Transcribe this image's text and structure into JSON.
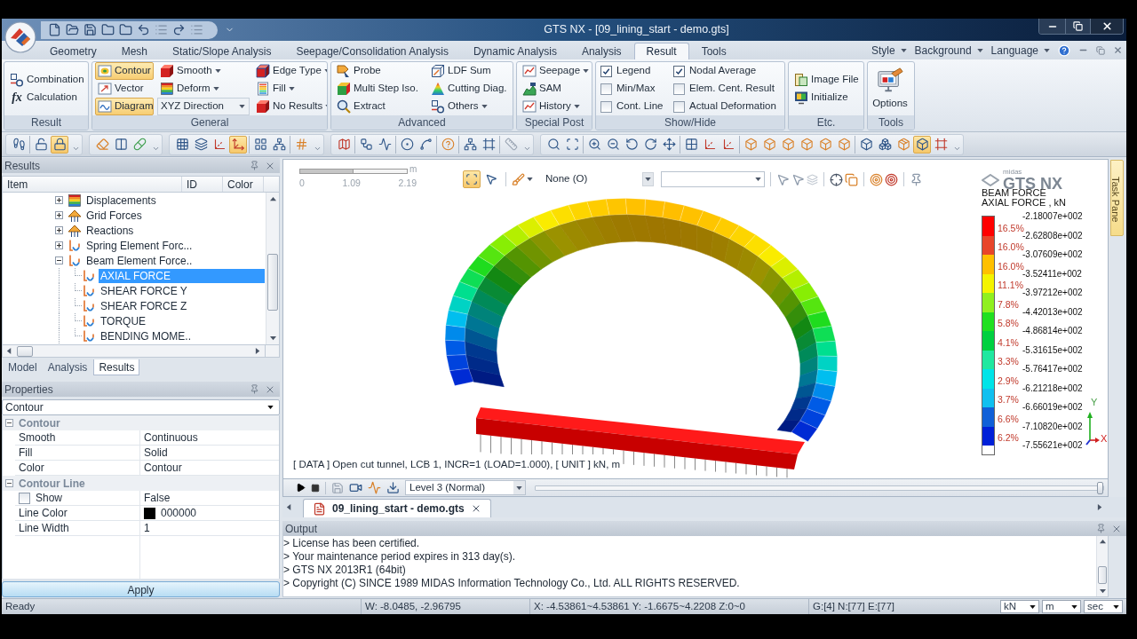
{
  "window": {
    "title": "GTS NX - [09_lining_start - demo.gts]"
  },
  "menu_tabs": [
    {
      "label": "Geometry",
      "selected": false
    },
    {
      "label": "Mesh",
      "selected": false
    },
    {
      "label": "Static/Slope Analysis",
      "selected": false
    },
    {
      "label": "Seepage/Consolidation Analysis",
      "selected": false
    },
    {
      "label": "Dynamic Analysis",
      "selected": false
    },
    {
      "label": "Analysis",
      "selected": false
    },
    {
      "label": "Result",
      "selected": true
    },
    {
      "label": "Tools",
      "selected": false
    }
  ],
  "menu_right": [
    "Style",
    "Background",
    "Language"
  ],
  "ribbon": [
    {
      "label": "Result",
      "columns": [
        [
          {
            "kind": "button",
            "label": "Combination"
          },
          {
            "kind": "button",
            "label": "Calculation",
            "glyph": "fx"
          }
        ]
      ]
    },
    {
      "label": "General",
      "columns": [
        [
          {
            "kind": "button",
            "label": "Contour",
            "selected": true
          },
          {
            "kind": "button",
            "label": "Vector",
            "selected": false
          },
          {
            "kind": "button",
            "label": "Diagram",
            "selected": true
          }
        ],
        [
          {
            "kind": "menu",
            "label": "Smooth"
          },
          {
            "kind": "menu",
            "label": "Deform"
          },
          {
            "kind": "select",
            "value": "XYZ Direction"
          }
        ],
        [
          {
            "kind": "menu",
            "label": "Edge Type"
          },
          {
            "kind": "menu",
            "label": "Fill"
          },
          {
            "kind": "menu",
            "label": "No Results"
          }
        ]
      ]
    },
    {
      "label": "Advanced",
      "columns": [
        [
          {
            "kind": "button",
            "label": "Probe"
          },
          {
            "kind": "button",
            "label": "Multi Step Iso."
          },
          {
            "kind": "button",
            "label": "Extract"
          }
        ],
        [
          {
            "kind": "button",
            "label": "LDF Sum"
          },
          {
            "kind": "button",
            "label": "Cutting Diag."
          },
          {
            "kind": "menu",
            "label": "Others"
          }
        ]
      ]
    },
    {
      "label": "Special Post",
      "columns": [
        [
          {
            "kind": "menu",
            "label": "Seepage"
          },
          {
            "kind": "button",
            "label": "SAM"
          },
          {
            "kind": "menu",
            "label": "History"
          }
        ]
      ]
    },
    {
      "label": "Show/Hide",
      "columns": [
        [
          {
            "kind": "check",
            "label": "Legend",
            "checked": true
          },
          {
            "kind": "check",
            "label": "Min/Max",
            "checked": false
          },
          {
            "kind": "check",
            "label": "Cont. Line",
            "checked": false
          }
        ],
        [
          {
            "kind": "check",
            "label": "Nodal Average",
            "checked": true
          },
          {
            "kind": "check",
            "label": "Elem. Cent. Result",
            "checked": false
          },
          {
            "kind": "check",
            "label": "Actual Deformation",
            "checked": false
          }
        ]
      ]
    },
    {
      "label": "Etc.",
      "columns": [
        [
          {
            "kind": "button",
            "label": "Image File"
          },
          {
            "kind": "button",
            "label": "Initialize"
          }
        ]
      ]
    },
    {
      "label": "Tools",
      "columns": [
        [
          {
            "kind": "big",
            "label": "Options"
          }
        ]
      ]
    }
  ],
  "toolbar": [
    [
      [
        {
          "on": false
        }
      ],
      [
        {
          "on": false
        },
        {
          "on": true
        }
      ]
    ],
    [
      [
        {
          "on": false
        },
        {
          "on": false
        },
        {
          "on": false
        }
      ]
    ],
    [
      [
        {
          "on": false
        },
        {
          "on": false
        },
        {
          "on": false
        },
        {
          "on": true
        }
      ],
      [
        {
          "on": false
        },
        {
          "on": false
        }
      ],
      [
        {
          "on": false
        }
      ]
    ],
    [
      [
        {
          "on": false
        }
      ],
      [
        {
          "on": false
        },
        {
          "on": false
        }
      ],
      [
        {
          "on": false
        },
        {
          "on": false
        }
      ],
      [
        {
          "on": false
        }
      ],
      [
        {
          "on": false
        },
        {
          "on": false
        }
      ],
      [
        {
          "on": false
        }
      ]
    ],
    [
      [
        {
          "on": false
        },
        {
          "on": false
        }
      ],
      [
        {
          "on": false
        },
        {
          "on": false
        },
        {
          "on": false
        },
        {
          "on": false
        },
        {
          "on": false
        }
      ],
      [
        {
          "on": false
        },
        {
          "on": false
        },
        {
          "on": false
        }
      ],
      [
        {
          "on": false
        },
        {
          "on": false
        },
        {
          "on": false
        },
        {
          "on": false
        },
        {
          "on": false
        },
        {
          "on": false
        }
      ],
      [
        {
          "on": false
        },
        {
          "on": false
        },
        {
          "on": false
        },
        {
          "on": true
        },
        {
          "on": false
        }
      ]
    ]
  ],
  "results_panel": {
    "title": "Results",
    "columns": [
      "Item",
      "ID",
      "Color"
    ],
    "tree": [
      {
        "label": "Displacements",
        "kind": "bars",
        "expanded": false,
        "selected": false
      },
      {
        "label": "Grid Forces",
        "kind": "arrows",
        "expanded": false,
        "selected": false
      },
      {
        "label": "Reactions",
        "kind": "arrows",
        "expanded": false,
        "selected": false
      },
      {
        "label": "Spring Element Forc...",
        "kind": "beam",
        "expanded": false,
        "selected": false
      },
      {
        "label": "Beam Element Force..",
        "kind": "beam",
        "expanded": true,
        "selected": false,
        "children": [
          {
            "label": "AXIAL FORCE",
            "kind": "beam",
            "selected": true
          },
          {
            "label": "SHEAR FORCE Y",
            "kind": "beam",
            "selected": false
          },
          {
            "label": "SHEAR FORCE Z",
            "kind": "beam",
            "selected": false
          },
          {
            "label": "TORQUE",
            "kind": "beam",
            "selected": false
          },
          {
            "label": "BENDING MOME..",
            "kind": "beam",
            "selected": false
          }
        ]
      }
    ],
    "tabs": [
      {
        "label": "Model",
        "selected": false
      },
      {
        "label": "Analysis",
        "selected": false
      },
      {
        "label": "Results",
        "selected": true
      }
    ]
  },
  "properties_panel": {
    "title": "Properties",
    "selector": "Contour",
    "groups": [
      {
        "label": "Contour",
        "expanded": true,
        "rows": [
          {
            "kind": "text",
            "name": "Smooth",
            "value": "Continuous"
          },
          {
            "kind": "text",
            "name": "Fill",
            "value": "Solid"
          },
          {
            "kind": "text",
            "name": "Color",
            "value": "Contour"
          }
        ]
      },
      {
        "label": "Contour Line",
        "expanded": true,
        "rows": [
          {
            "kind": "check",
            "name": "Show",
            "checked": false,
            "value": "False"
          },
          {
            "kind": "color",
            "name": "Line Color",
            "color": "#000000",
            "value": "000000"
          },
          {
            "kind": "text",
            "name": "Line Width",
            "value": "1"
          }
        ]
      }
    ],
    "apply": "Apply"
  },
  "viewport": {
    "scale_bar": {
      "ticks": [
        "0",
        "1.09",
        "2.19"
      ],
      "unit": "m"
    },
    "view_toolbar": {
      "toggles": [
        {
          "on": true
        },
        {
          "on": false
        }
      ],
      "display_select": "None (O)"
    },
    "brand_mark": {
      "maker": "midas",
      "product": "GTS NX"
    },
    "legend": {
      "title": [
        "BEAM FORCE",
        "AXIAL FORCE , kN"
      ],
      "bands": [
        {
          "color": "#ff0000",
          "share": "16.5%"
        },
        {
          "color": "#e8452a",
          "share": "16.0%"
        },
        {
          "color": "#ffc000",
          "share": "16.0%"
        },
        {
          "color": "#f4f400",
          "share": "11.1%"
        },
        {
          "color": "#90f020",
          "share": "7.8%"
        },
        {
          "color": "#20e020",
          "share": "5.8%"
        },
        {
          "color": "#00d040",
          "share": "4.1%"
        },
        {
          "color": "#20e8a0",
          "share": "3.3%"
        },
        {
          "color": "#00e4e8",
          "share": "2.9%"
        },
        {
          "color": "#10c0f0",
          "share": "3.7%"
        },
        {
          "color": "#1060d8",
          "share": "6.6%"
        },
        {
          "color": "#0020d8",
          "share": "6.2%"
        }
      ],
      "values": [
        "-2.18007e+002",
        "-2.62808e+002",
        "-3.07609e+002",
        "-3.52411e+002",
        "-3.97212e+002",
        "-4.42013e+002",
        "-4.86814e+002",
        "-5.31615e+002",
        "-5.76417e+002",
        "-6.21218e+002",
        "-6.66019e+002",
        "-7.10820e+002",
        "-7.55621e+002"
      ]
    },
    "axis_labels": [
      "Y",
      "X"
    ],
    "info_line": "[ DATA ] Open cut tunnel, LCB 1, INCR=1 (LOAD=1.000), [ UNIT ] kN, m"
  },
  "task_pane_tab": "Task Pane",
  "player_bar": {
    "detail_select": "Level 3 (Normal)",
    "slider": {
      "level": 1
    }
  },
  "document_tabs": [
    {
      "label": "09_lining_start - demo.gts",
      "selected": true
    }
  ],
  "output": {
    "title": "Output",
    "lines": [
      "> License has been certified.",
      "> Your maintenance period expires in 313 day(s).",
      "> GTS NX 2013R1 (64bit)",
      "> Copyright (C) SINCE 1989 MIDAS Information Technology Co., Ltd. ALL RIGHTS RESERVED."
    ]
  },
  "status_bar": {
    "message": "Ready",
    "cursor": "W: -8.0485, -2.96795",
    "extent": "X: -4.53861~4.53861 Y: -1.6675~4.2208 Z:0~0",
    "counts": "G:[4] N:[77] E:[77]",
    "units": [
      "kN",
      "m",
      "sec"
    ]
  }
}
